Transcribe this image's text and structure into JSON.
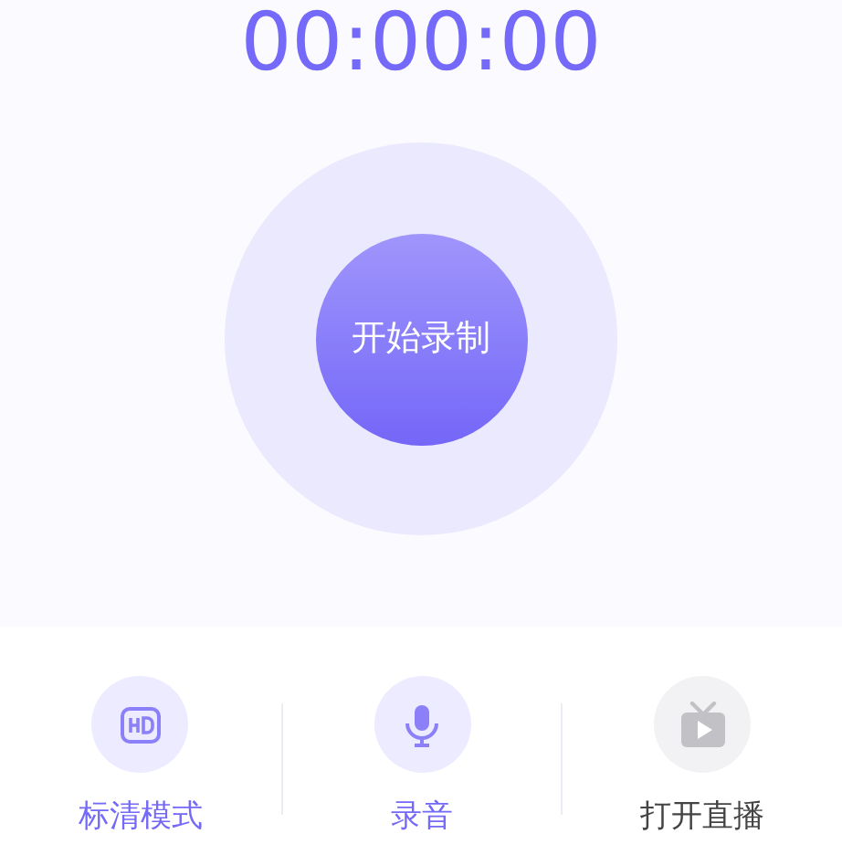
{
  "timer": "00:00:00",
  "record_button": {
    "label": "开始录制"
  },
  "actions": [
    {
      "kind": "hd",
      "label": "标清模式",
      "active": true
    },
    {
      "kind": "mic",
      "label": "录音",
      "active": true
    },
    {
      "kind": "tv",
      "label": "打开直播",
      "active": false
    }
  ]
}
